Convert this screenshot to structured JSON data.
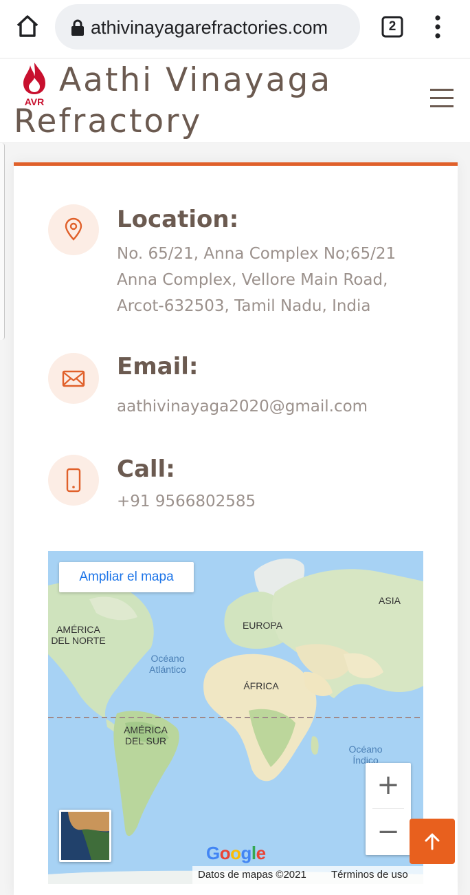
{
  "browser": {
    "url": "athivinayagarefractories.com",
    "tab_count": "2"
  },
  "header": {
    "logo_text": "AVR",
    "brand_line1": "Aathi Vinayaga",
    "brand_line2": "Refractory"
  },
  "contact": {
    "location": {
      "title": "Location:",
      "line1": "No. 65/21, Anna Complex No;65/21",
      "line2": "Anna Complex, Vellore Main Road,",
      "line3": "Arcot-632503, Tamil Nadu, India",
      "icon": "map-pin-icon"
    },
    "email": {
      "title": "Email:",
      "value": "aathivinayaga2020@gmail.com",
      "icon": "envelope-icon"
    },
    "call": {
      "title": "Call:",
      "value": "+91 9566802585",
      "icon": "phone-icon"
    }
  },
  "map": {
    "expand_label": "Ampliar el mapa",
    "labels": {
      "north_america_1": "AMÉRICA",
      "north_america_2": "DEL NORTE",
      "europe": "EUROPA",
      "asia": "ASIA",
      "africa": "ÁFRICA",
      "south_america_1": "AMÉRICA",
      "south_america_2": "DEL SUR",
      "atlantic_1": "Océano",
      "atlantic_2": "Atlántico",
      "indian_1": "Océano",
      "indian_2": "Índico"
    },
    "zoom_in": "+",
    "zoom_out": "−",
    "google": "Google",
    "credits": "Datos de mapas ©2021",
    "terms": "Términos de uso"
  },
  "colors": {
    "accent": "#e0602a",
    "brand_text": "#6b5a50",
    "icon_bg": "#fcede5",
    "body_text": "#9b918c"
  }
}
